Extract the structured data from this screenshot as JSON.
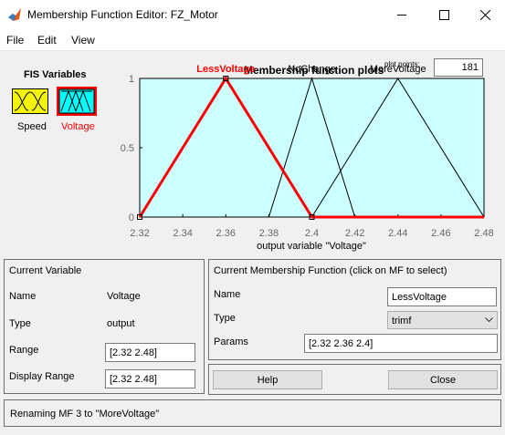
{
  "window": {
    "title": "Membership Function Editor: FZ_Motor"
  },
  "menu": {
    "file": "File",
    "edit": "Edit",
    "view": "View"
  },
  "fis_variables": {
    "title": "FIS Variables",
    "items": [
      {
        "label": "Speed",
        "selected": false,
        "color": "#f4f40b"
      },
      {
        "label": "Voltage",
        "selected": true,
        "color": "#00ffff"
      }
    ]
  },
  "plot": {
    "title": "Membership function plots",
    "points_label": "plot points:",
    "points_value": "181"
  },
  "chart_data": {
    "type": "line",
    "xlabel": "output variable \"Voltage\"",
    "xlim": [
      2.32,
      2.48
    ],
    "ylim": [
      0,
      1
    ],
    "x_ticks": [
      "2.32",
      "2.34",
      "2.36",
      "2.38",
      "2.4",
      "2.42",
      "2.44",
      "2.46",
      "2.48"
    ],
    "y_ticks": [
      "0",
      "0.5",
      "1"
    ],
    "background": "#ccffff",
    "series": [
      {
        "name": "LessVoltage",
        "points": [
          [
            2.32,
            0
          ],
          [
            2.36,
            1
          ],
          [
            2.4,
            0
          ],
          [
            2.48,
            0
          ]
        ],
        "color": "#ff0000",
        "selected": true
      },
      {
        "name": "NoChange",
        "points": [
          [
            2.32,
            0
          ],
          [
            2.38,
            0
          ],
          [
            2.4,
            1
          ],
          [
            2.42,
            0
          ],
          [
            2.48,
            0
          ]
        ],
        "color": "#000000",
        "selected": false
      },
      {
        "name": "MoreVoltage",
        "points": [
          [
            2.32,
            0
          ],
          [
            2.4,
            0
          ],
          [
            2.44,
            1
          ],
          [
            2.48,
            0
          ]
        ],
        "color": "#000000",
        "selected": false
      }
    ]
  },
  "current_variable": {
    "title": "Current Variable",
    "name_label": "Name",
    "name_value": "Voltage",
    "type_label": "Type",
    "type_value": "output",
    "range_label": "Range",
    "range_value": "[2.32 2.48]",
    "display_range_label": "Display Range",
    "display_range_value": "[2.32 2.48]"
  },
  "current_mf": {
    "title": "Current Membership Function (click on MF to select)",
    "name_label": "Name",
    "name_value": "LessVoltage",
    "type_label": "Type",
    "type_value": "trimf",
    "params_label": "Params",
    "params_value": "[2.32 2.36 2.4]"
  },
  "buttons": {
    "help": "Help",
    "close": "Close"
  },
  "status": "Renaming MF 3 to \"MoreVoltage\""
}
